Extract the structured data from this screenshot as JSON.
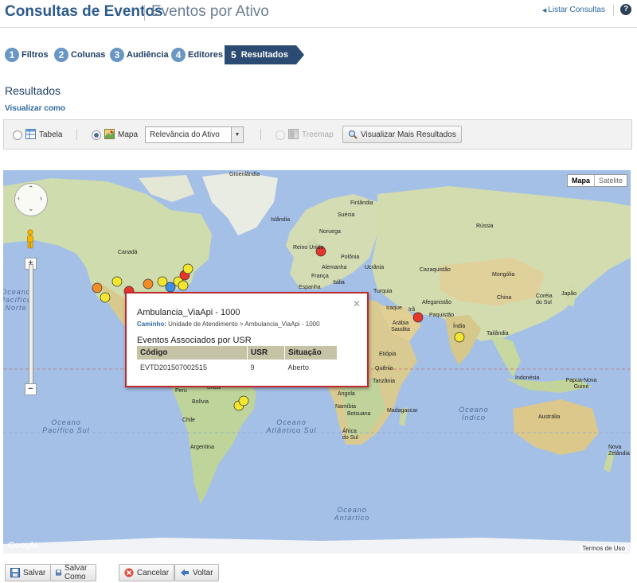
{
  "header": {
    "title": "Consultas de Eventos",
    "subtitle": "Eventos por Ativo",
    "list_link": "Listar Consultas",
    "help": "?"
  },
  "steps": [
    {
      "num": "1",
      "label": "Filtros"
    },
    {
      "num": "2",
      "label": "Colunas"
    },
    {
      "num": "3",
      "label": "Audiência"
    },
    {
      "num": "4",
      "label": "Editores"
    },
    {
      "num": "5",
      "label": "Resultados"
    }
  ],
  "section_title": "Resultados",
  "view_as": "Visualizar como",
  "toolbar": {
    "table_label": "Tabela",
    "map_label": "Mapa",
    "select_value": "Relevância do Ativo",
    "treemap_label": "Treemap",
    "more_results": "Visualizar Mais Resultados",
    "selected_view": "Mapa"
  },
  "map": {
    "type_map": "Mapa",
    "type_satellite": "Satélite",
    "google": "Google",
    "terms": "Termos de Uso",
    "labels": {
      "groenlandia": "Groenlândia",
      "islandia": "Islândia",
      "finlandia": "Finlândia",
      "suecia": "Suécia",
      "noruega": "Noruega",
      "russia": "Rússia",
      "reino_unido": "Reino Unido",
      "polonia": "Polônia",
      "alemanha": "Alemanha",
      "ucrania": "Ucrânia",
      "franca": "França",
      "italia": "Itália",
      "cazaquistao": "Cazaquistão",
      "mongolia": "Mongólia",
      "espanha": "Espanha",
      "turquia": "Turquia",
      "china": "China",
      "coreia": "Coréia do Sul",
      "japao": "Japão",
      "afeganistao": "Afeganistão",
      "ira": "Irã",
      "iraque": "Iraque",
      "paquistao": "Paquistão",
      "arabia": "Arábia Saudita",
      "india": "Índia",
      "tailandia": "Tailândia",
      "canada": "Canadá",
      "etiopia": "Etiópia",
      "quenia": "Quênia",
      "tanzania": "Tanzânia",
      "indonesia": "Indonésia",
      "papua": "Papua-Nova Guiné",
      "peru": "Peru",
      "brasil": "Brasil",
      "bolivia": "Bolívia",
      "chile": "Chile",
      "argentina": "Argentina",
      "angola": "Angola",
      "namibia": "Namíbia",
      "botsuana": "Botsuana",
      "madagascar": "Madagascar",
      "africa_sul": "África do Sul",
      "australia": "Austrália",
      "nova_zelandia": "Nova Zelândia"
    },
    "oceans": {
      "pacifico_norte": "Oceano Pacífico Norte",
      "pacifico_sul": "Oceano Pacífico Sul",
      "atlantico_sul": "Oceano Atlântico Sul",
      "indico": "Oceano Índico",
      "antartico": "Oceano Antártico"
    }
  },
  "popup": {
    "title": "Ambulancia_ViaApi - 1000",
    "path_label": "Caminho:",
    "path_value": "Unidade de Atendimento > Ambulancia_ViaApi - 1000",
    "section": "Eventos Associados por USR",
    "columns": [
      "Código",
      "USR",
      "Situação"
    ],
    "rows": [
      {
        "codigo": "EVTD201507002515",
        "usr": "9",
        "situacao": "Aberto"
      }
    ]
  },
  "footer": {
    "save": "Salvar",
    "save_as": "Salvar Como",
    "cancel": "Cancelar",
    "back": "Voltar"
  }
}
